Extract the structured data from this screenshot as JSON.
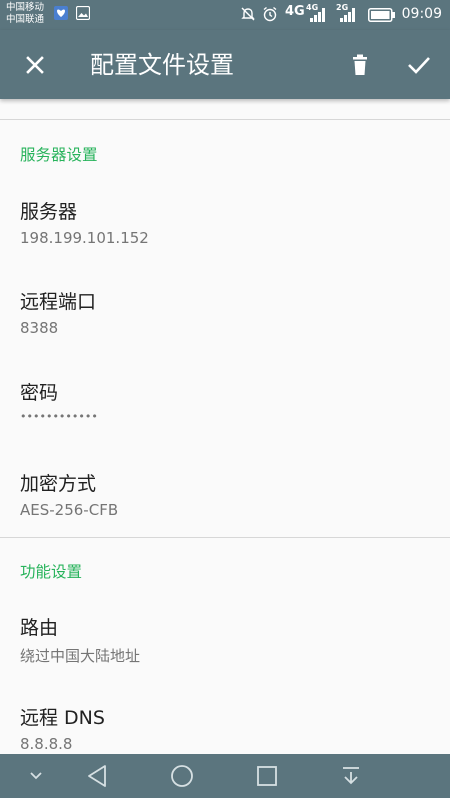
{
  "status_bar": {
    "carrier_1": "中国移动",
    "carrier_2": "中国联通",
    "network_1": "4G",
    "network_2": "4G",
    "network_3": "2G",
    "time": "09:09"
  },
  "app_bar": {
    "title": "配置文件设置"
  },
  "sections": [
    {
      "header": "服务器设置",
      "items": [
        {
          "title": "服务器",
          "summary": "198.199.101.152"
        },
        {
          "title": "远程端口",
          "summary": "8388"
        },
        {
          "title": "密码",
          "summary": "••••••••••••"
        },
        {
          "title": "加密方式",
          "summary": "AES-256-CFB"
        }
      ]
    },
    {
      "header": "功能设置",
      "items": [
        {
          "title": "路由",
          "summary": "绕过中国大陆地址"
        },
        {
          "title": "远程 DNS",
          "summary": "8.8.8.8"
        }
      ]
    }
  ],
  "colors": {
    "primary": "#5b757e",
    "accent": "#27b35b",
    "text_primary": "#212121",
    "text_secondary": "#757575"
  }
}
